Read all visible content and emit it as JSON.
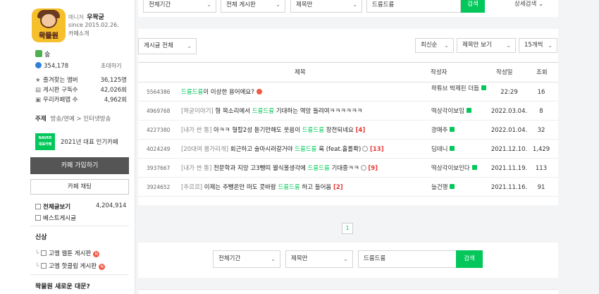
{
  "sidebar": {
    "manager_label": "매니저",
    "manager_name": "우왁굳",
    "since": "since 2015.02.26.",
    "cafe_intro": "카페소개",
    "logo_text": "왁물원",
    "rank": "숲",
    "members": "354,178",
    "invite": "초대하기",
    "fav_label": "즐겨찾는 멤버",
    "fav_value": "36,125명",
    "sub_label": "게시판 구독수",
    "sub_value": "42,026회",
    "app_label": "우리카페앱 수",
    "app_value": "4,962회",
    "theme_label": "주제",
    "theme_value": "방송/연예 > 인터넷방송",
    "naver_badge_line1": "NAVER",
    "naver_badge_line2": "대표카페",
    "award": "2021년 대표 인기카페",
    "join_button": "카페 가입하기",
    "chat_button": "카페 채팅",
    "all_posts": "전체글보기",
    "all_posts_count": "4,204,914",
    "best_board": "베스트게시글",
    "new_section": "신상",
    "new_items": [
      "고멤 웹툰 게시판",
      "고멤 핫클립 게시판"
    ],
    "news_section": "왁물원 새로운 대문?"
  },
  "top_search": {
    "period": "전체기간",
    "board": "전체 게시판",
    "scope": "제목만",
    "query": "드륭드륭",
    "button": "검색",
    "detail": "상세검색"
  },
  "list_controls": {
    "filter": "게시글 전체",
    "sort": "최신순",
    "view": "제목만 보기",
    "per_page": "15개씩"
  },
  "table": {
    "headers": {
      "title": "제목",
      "author": "작성자",
      "date": "작성일",
      "views": "조회"
    },
    "rows": [
      {
        "num": "5564386",
        "cat": "",
        "pre": "",
        "hl": "드륭드륭",
        "post": "이 이상한 용어에요?",
        "cm": "",
        "author": "왁튜브 박제된 더듬",
        "date": "22:29",
        "views": "16"
      },
      {
        "num": "4969768",
        "cat": "[왁굳이야기]",
        "pre": " 형 목소리에서 ",
        "hl": "드륭드륭",
        "post": " 기대하는 역망 들려여ㅋㅋㅋㅋㅋㅋ",
        "cm": "",
        "author": "떡상각이보임",
        "date": "2022.03.04.",
        "views": "8"
      },
      {
        "num": "4227380",
        "cat": "[내가 싼 똥]",
        "pre": " 아ㅋㅋ 혈칼2성 듣기만해도 웃음이 ",
        "hl": "드륭드륭",
        "post": " 장전되네요",
        "cm": "[4]",
        "author": "광매주",
        "date": "2022.01.04.",
        "views": "32"
      },
      {
        "num": "4024249",
        "cat": "[20대여 몸가리개]",
        "pre": " 회근하고 술마시러갈거야 ",
        "hl": "드륭드륭",
        "post": " 룩 (feat.홀롤롹)",
        "cm": "[13]",
        "author": "딤데니",
        "date": "2021.12.10.",
        "views": "1,429"
      },
      {
        "num": "3937667",
        "cat": "[내가 싼 똥]",
        "pre": " 전문학과 지망 고3뺑띠 웰식볼생각에 ",
        "hl": "드륭드륭",
        "post": " 기대중ㅋㅋ",
        "cm": "[9]",
        "author": "떡상각이보인다",
        "date": "2021.11.19.",
        "views": "113"
      },
      {
        "num": "3924652",
        "cat": "[주르르]",
        "pre": " 이제는 주뺑온만 떠도 콧바람 ",
        "hl": "드륭드륭",
        "post": " 하고 들어옴",
        "cm": "[2]",
        "author": "늘건행",
        "date": "2021.11.16.",
        "views": "91"
      }
    ]
  },
  "pager": {
    "current": "1"
  },
  "bottom_search": {
    "period": "전체기간",
    "scope": "제목만",
    "query": "드륭드륭",
    "button": "검색"
  }
}
